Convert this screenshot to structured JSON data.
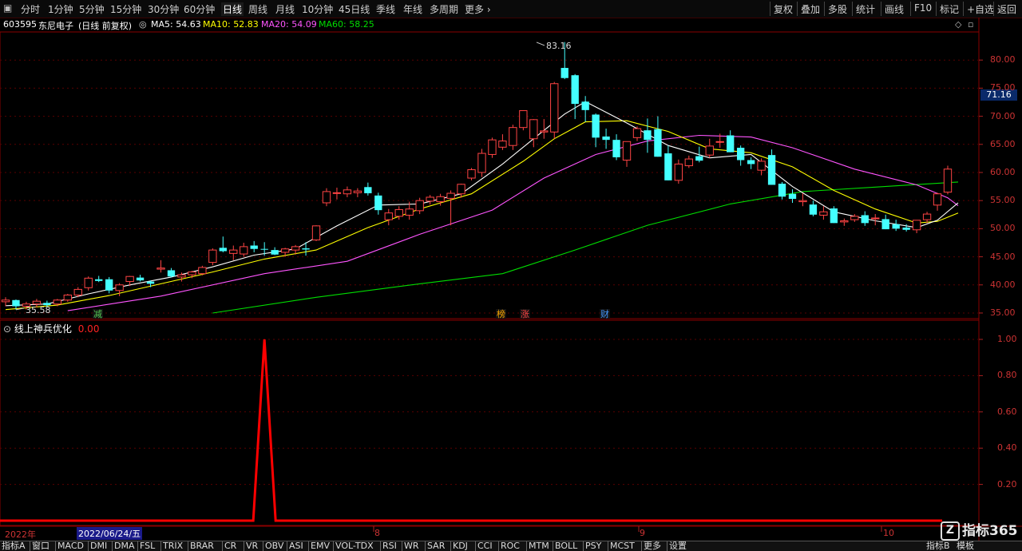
{
  "toolbar": {
    "periods": [
      "分时",
      "1分钟",
      "5分钟",
      "15分钟",
      "30分钟",
      "60分钟",
      "日线",
      "周线",
      "月线",
      "10分钟",
      "45日线",
      "季线",
      "年线",
      "多周期",
      "更多"
    ],
    "active_period": "日线",
    "right_buttons": [
      "复权",
      "叠加",
      "多股",
      "统计",
      "画线",
      "F10",
      "标记",
      "+自选",
      "返回"
    ]
  },
  "stock": {
    "code": "603595",
    "name": "东尼电子",
    "mode": "(日线 前复权)"
  },
  "ma": {
    "ma5": "MA5: 54.63",
    "ma10": "MA10: 52.83",
    "ma20": "MA20: 54.09",
    "ma60": "MA60: 58.25"
  },
  "colors": {
    "ma5": "#ffffff",
    "ma10": "#ffff00",
    "ma20": "#ff55ff",
    "ma60": "#00dd00",
    "up": "#ff4444",
    "down": "#44ffff",
    "grid": "#5a0000",
    "indicator_line": "#ff0000"
  },
  "price_axis": [
    "80.00",
    "75.00",
    "70.00",
    "65.00",
    "60.00",
    "55.00",
    "50.00",
    "45.00",
    "40.00",
    "35.00"
  ],
  "current_price": "71.16",
  "high_mark": "83.16",
  "low_mark": "35.58",
  "event_markers": [
    "减",
    "榜",
    "涨",
    "财"
  ],
  "indicator": {
    "name": "线上神兵优化",
    "value": "0.00",
    "axis": [
      "1.00",
      "0.80",
      "0.60",
      "0.40",
      "0.20"
    ],
    "signal_value": 1.0
  },
  "date_axis": {
    "year": "2022年",
    "cursor_date": "2022/06/24/五",
    "months": [
      "8",
      "9",
      "10"
    ],
    "ticker": "日线"
  },
  "bottom_tabs": [
    "指标A",
    "窗口",
    "MACD",
    "DMI",
    "DMA",
    "FSL",
    "TRIX",
    "BRAR",
    "CR",
    "VR",
    "OBV",
    "ASI",
    "EMV",
    "VOL-TDX",
    "RSI",
    "WR",
    "SAR",
    "KDJ",
    "CCI",
    "ROC",
    "MTM",
    "BOLL",
    "PSY",
    "MCST",
    "更多",
    "设置"
  ],
  "bottom_right": [
    "指标B",
    "模板"
  ],
  "logo": "指标365",
  "chart_data": {
    "type": "candlestick",
    "ylim": [
      34,
      85
    ],
    "candles": [
      [
        37.0,
        37.8,
        36.2,
        37.3
      ],
      [
        37.3,
        37.4,
        35.6,
        36.2
      ],
      [
        36.2,
        37.0,
        35.6,
        36.6
      ],
      [
        36.6,
        37.5,
        36.0,
        37.1
      ],
      [
        36.8,
        37.2,
        36.0,
        36.4
      ],
      [
        36.6,
        37.5,
        36.2,
        37.3
      ],
      [
        37.3,
        38.4,
        37.0,
        38.2
      ],
      [
        38.2,
        39.6,
        37.8,
        39.2
      ],
      [
        39.5,
        41.5,
        39.0,
        41.2
      ],
      [
        41.0,
        41.6,
        40.5,
        40.7
      ],
      [
        41.0,
        41.4,
        38.5,
        39.0
      ],
      [
        39.0,
        40.3,
        38.0,
        40.0
      ],
      [
        40.6,
        41.6,
        39.8,
        41.5
      ],
      [
        41.3,
        41.8,
        40.6,
        40.8
      ],
      [
        40.6,
        40.8,
        39.6,
        40.2
      ],
      [
        42.8,
        44.4,
        42.2,
        43.0
      ],
      [
        42.6,
        43.0,
        41.3,
        41.5
      ],
      [
        41.4,
        42.2,
        40.6,
        41.8
      ],
      [
        41.8,
        42.5,
        41.2,
        42.3
      ],
      [
        42.0,
        43.4,
        41.7,
        43.1
      ],
      [
        44.0,
        46.5,
        43.5,
        46.2
      ],
      [
        46.6,
        48.6,
        45.8,
        46.0
      ],
      [
        45.6,
        47.0,
        44.4,
        46.2
      ],
      [
        45.5,
        47.5,
        45.0,
        46.8
      ],
      [
        47.0,
        47.8,
        45.8,
        46.4
      ],
      [
        46.4,
        47.6,
        45.2,
        46.3
      ],
      [
        46.2,
        46.7,
        45.3,
        45.4
      ],
      [
        45.8,
        46.6,
        45.0,
        46.4
      ],
      [
        46.2,
        47.1,
        45.4,
        46.8
      ],
      [
        46.5,
        47.6,
        45.2,
        46.3
      ],
      [
        48.0,
        50.6,
        47.8,
        50.5
      ],
      [
        54.6,
        57.2,
        54.0,
        56.6
      ],
      [
        56.3,
        57.3,
        55.2,
        56.4
      ],
      [
        56.2,
        57.5,
        55.6,
        56.9
      ],
      [
        56.4,
        57.2,
        55.6,
        56.7
      ],
      [
        57.4,
        58.2,
        55.9,
        56.3
      ],
      [
        55.9,
        56.4,
        52.5,
        53.3
      ],
      [
        51.6,
        53.5,
        50.6,
        52.8
      ],
      [
        52.2,
        54.0,
        51.6,
        53.4
      ],
      [
        52.4,
        54.8,
        51.6,
        53.5
      ],
      [
        53.2,
        55.5,
        52.6,
        55.0
      ],
      [
        54.9,
        56.0,
        54.3,
        55.6
      ],
      [
        54.8,
        56.2,
        54.1,
        55.7
      ],
      [
        55.4,
        56.8,
        50.6,
        56.3
      ],
      [
        56.2,
        58.0,
        55.5,
        57.9
      ],
      [
        59.0,
        60.8,
        58.6,
        60.5
      ],
      [
        60.0,
        64.2,
        59.2,
        63.4
      ],
      [
        63.2,
        66.2,
        62.6,
        65.8
      ],
      [
        64.5,
        66.8,
        64.0,
        65.6
      ],
      [
        64.8,
        68.5,
        64.0,
        68.0
      ],
      [
        68.0,
        71.0,
        67.5,
        71.0
      ],
      [
        66.0,
        69.5,
        64.5,
        69.4
      ],
      [
        67.2,
        69.5,
        66.0,
        67.4
      ],
      [
        67.2,
        76.1,
        66.0,
        75.8
      ],
      [
        78.6,
        83.2,
        76.6,
        76.8
      ],
      [
        77.3,
        77.5,
        69.5,
        72.2
      ],
      [
        72.6,
        73.6,
        69.0,
        71.1
      ],
      [
        70.3,
        70.5,
        64.5,
        66.2
      ],
      [
        66.4,
        67.8,
        64.2,
        65.8
      ],
      [
        65.8,
        66.8,
        62.2,
        62.7
      ],
      [
        62.2,
        65.5,
        61.0,
        65.5
      ],
      [
        66.2,
        68.2,
        65.6,
        67.8
      ],
      [
        67.5,
        69.6,
        63.5,
        65.8
      ],
      [
        67.7,
        70.0,
        62.8,
        62.8
      ],
      [
        63.4,
        64.8,
        58.6,
        58.6
      ],
      [
        58.6,
        62.3,
        58.0,
        61.5
      ],
      [
        61.2,
        63.0,
        60.8,
        62.4
      ],
      [
        62.9,
        64.6,
        61.8,
        62.1
      ],
      [
        63.1,
        66.0,
        62.6,
        64.7
      ],
      [
        65.5,
        66.9,
        64.4,
        65.5
      ],
      [
        66.6,
        67.5,
        63.6,
        63.6
      ],
      [
        64.4,
        64.8,
        61.2,
        62.2
      ],
      [
        62.2,
        62.7,
        60.6,
        61.5
      ],
      [
        60.4,
        62.5,
        59.5,
        62.0
      ],
      [
        63.1,
        64.1,
        57.8,
        57.8
      ],
      [
        58.0,
        58.3,
        55.2,
        55.7
      ],
      [
        56.2,
        57.0,
        54.6,
        55.3
      ],
      [
        54.8,
        56.3,
        54.0,
        55.0
      ],
      [
        54.3,
        55.0,
        52.2,
        52.5
      ],
      [
        52.4,
        54.0,
        51.6,
        53.0
      ],
      [
        53.6,
        54.0,
        51.0,
        51.0
      ],
      [
        51.2,
        51.8,
        50.5,
        51.4
      ],
      [
        51.6,
        52.6,
        51.2,
        52.2
      ],
      [
        52.4,
        53.1,
        50.5,
        51.0
      ],
      [
        51.8,
        52.6,
        50.6,
        51.9
      ],
      [
        51.7,
        52.5,
        49.9,
        49.9
      ],
      [
        50.8,
        51.6,
        49.6,
        50.0
      ],
      [
        50.2,
        50.8,
        49.5,
        49.8
      ],
      [
        49.8,
        51.5,
        49.2,
        51.5
      ],
      [
        51.6,
        53.0,
        51.0,
        52.6
      ],
      [
        54.2,
        56.4,
        53.2,
        56.2
      ],
      [
        56.5,
        61.2,
        56.1,
        60.6
      ]
    ],
    "ma5": [
      [
        0,
        36.3
      ],
      [
        4,
        36.6
      ],
      [
        8,
        38.4
      ],
      [
        12,
        40.0
      ],
      [
        16,
        41.4
      ],
      [
        20,
        43.2
      ],
      [
        24,
        45.3
      ],
      [
        28,
        46.4
      ],
      [
        32,
        50.5
      ],
      [
        36,
        54.2
      ],
      [
        40,
        54.4
      ],
      [
        44,
        56.2
      ],
      [
        48,
        61.5
      ],
      [
        52,
        67.5
      ],
      [
        54,
        70.4
      ],
      [
        56,
        72.6
      ],
      [
        60,
        68.8
      ],
      [
        64,
        64.8
      ],
      [
        68,
        62.6
      ],
      [
        72,
        63.2
      ],
      [
        76,
        57.5
      ],
      [
        80,
        53.0
      ],
      [
        84,
        51.4
      ],
      [
        88,
        50.2
      ],
      [
        90,
        51.5
      ],
      [
        92,
        54.6
      ]
    ],
    "ma10": [
      [
        0,
        35.6
      ],
      [
        5,
        36.4
      ],
      [
        10,
        38.1
      ],
      [
        15,
        40.2
      ],
      [
        20,
        42.3
      ],
      [
        25,
        44.6
      ],
      [
        30,
        46.2
      ],
      [
        35,
        50.2
      ],
      [
        40,
        53.5
      ],
      [
        45,
        56.2
      ],
      [
        50,
        62.0
      ],
      [
        53,
        66.0
      ],
      [
        56,
        69.0
      ],
      [
        60,
        69.2
      ],
      [
        64,
        67.3
      ],
      [
        68,
        64.2
      ],
      [
        72,
        63.5
      ],
      [
        76,
        61.0
      ],
      [
        80,
        56.8
      ],
      [
        84,
        53.5
      ],
      [
        88,
        51.0
      ],
      [
        90,
        51.3
      ],
      [
        92,
        52.8
      ]
    ],
    "ma20": [
      [
        6,
        35.4
      ],
      [
        15,
        38.0
      ],
      [
        25,
        42.0
      ],
      [
        33,
        44.2
      ],
      [
        40,
        49.0
      ],
      [
        47,
        53.3
      ],
      [
        52,
        59.0
      ],
      [
        57,
        63.2
      ],
      [
        62,
        65.6
      ],
      [
        67,
        66.6
      ],
      [
        72,
        66.3
      ],
      [
        76,
        64.4
      ],
      [
        82,
        60.6
      ],
      [
        88,
        57.8
      ],
      [
        91,
        55.5
      ],
      [
        92,
        54.1
      ]
    ],
    "ma60": [
      [
        20,
        35.0
      ],
      [
        30,
        37.8
      ],
      [
        40,
        40.2
      ],
      [
        48,
        42.0
      ],
      [
        55,
        46.2
      ],
      [
        62,
        50.6
      ],
      [
        70,
        54.4
      ],
      [
        77,
        56.6
      ],
      [
        84,
        57.4
      ],
      [
        92,
        58.3
      ]
    ],
    "indicator_signal_index": 25
  }
}
